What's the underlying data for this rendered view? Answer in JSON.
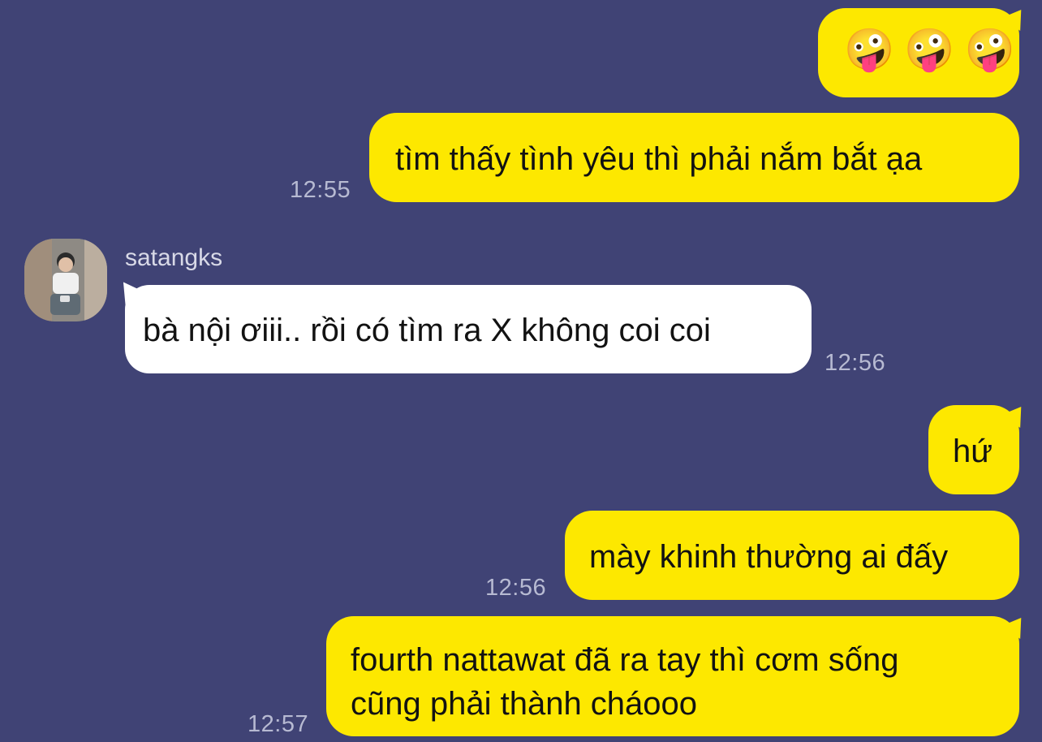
{
  "chat": {
    "messages": [
      {
        "direction": "outgoing",
        "emojis": [
          "🤪",
          "🤪",
          "🤪"
        ]
      },
      {
        "direction": "outgoing",
        "text": "tìm thấy tình yêu thì phải nắm bắt ạa",
        "time": "12:55"
      },
      {
        "direction": "incoming",
        "sender": "satangks",
        "text": "bà nội ơiii.. rồi có tìm ra X không coi coi",
        "time": "12:56"
      },
      {
        "direction": "outgoing",
        "text": "hứ"
      },
      {
        "direction": "outgoing",
        "text": "mày khinh thường ai đấy",
        "time": "12:56"
      },
      {
        "direction": "outgoing",
        "text_lines": [
          "fourth nattawat đã ra tay thì cơm sống",
          "cũng phải thành cháooo"
        ],
        "time": "12:57"
      }
    ]
  },
  "colors": {
    "background": "#404375",
    "outgoing_bubble": "#fde800",
    "incoming_bubble": "#ffffff",
    "text": "#121212",
    "timestamp": "#b7bad2",
    "sender_name": "#d8d9e7"
  }
}
